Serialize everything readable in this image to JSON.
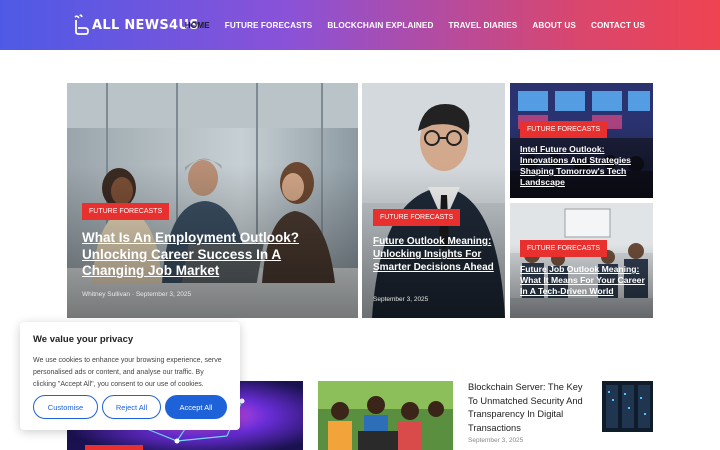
{
  "brand": {
    "name": "ALL NEWS4US",
    "accent": "#e8312f"
  },
  "nav": {
    "items": [
      {
        "label": "HOME",
        "active": true
      },
      {
        "label": "FUTURE FORECASTS"
      },
      {
        "label": "BLOCKCHAIN EXPLAINED"
      },
      {
        "label": "TRAVEL DIARIES"
      },
      {
        "label": "ABOUT US"
      },
      {
        "label": "CONTACT US"
      }
    ]
  },
  "featured": [
    {
      "category": "FUTURE FORECASTS",
      "title": "What Is An Employment Outlook? Unlocking Career Success In A Changing Job Market",
      "meta": "Whitney Sullivan · September 3, 2025"
    },
    {
      "category": "FUTURE FORECASTS",
      "title": "Future Outlook Meaning: Unlocking Insights For Smarter Decisions Ahead",
      "meta": "September 3, 2025"
    },
    {
      "category": "FUTURE FORECASTS",
      "title": "Intel Future Outlook: Innovations And Strategies Shaping Tomorrow's Tech Landscape"
    },
    {
      "category": "FUTURE FORECASTS",
      "title": "Future Job Outlook Meaning: What It Means For Your Career In A Tech-Driven World"
    }
  ],
  "side_post": {
    "title": "Blockchain Server: The Key To Unmatched Security And Transparency In Digital Transactions",
    "date": "September 3, 2025"
  },
  "cookie": {
    "heading": "We value your privacy",
    "body": "We use cookies to enhance your browsing experience, serve personalised ads or content, and analyse our traffic. By clicking \"Accept All\", you consent to our use of cookies.",
    "customise": "Customise",
    "reject": "Reject All",
    "accept": "Accept All"
  }
}
